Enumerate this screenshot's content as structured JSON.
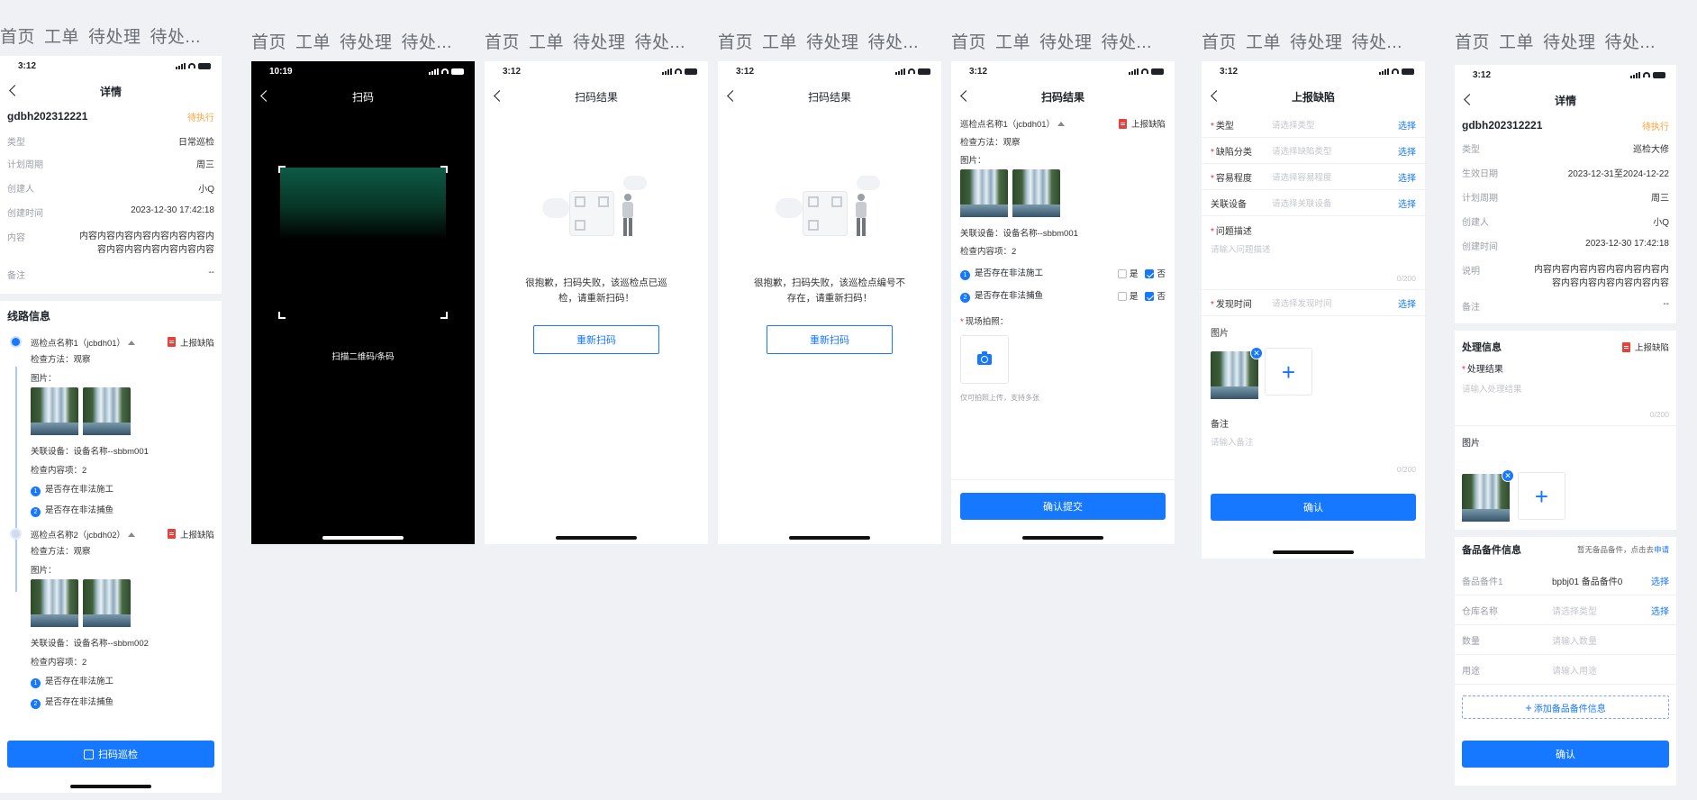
{
  "board_tabs": [
    "首页",
    "工单",
    "待处理",
    "待处..."
  ],
  "colors": {
    "primary": "#1677ff",
    "warning": "#f7a33b",
    "danger": "#e7413c"
  },
  "status_time": {
    "default": "3:12",
    "scan": "10:19"
  },
  "screen1": {
    "title": "详情",
    "code": "gdbh202312221",
    "status": "待执行",
    "fields": [
      {
        "k": "类型",
        "v": "日常巡检"
      },
      {
        "k": "计划周期",
        "v": "周三"
      },
      {
        "k": "创建人",
        "v": "小Q"
      },
      {
        "k": "创建时间",
        "v": "2023-12-30 17:42:18"
      },
      {
        "k": "内容",
        "v": "内容内容内容内容内容内容内容内容内容内容内容内容内容内容"
      },
      {
        "k": "备注",
        "v": "--"
      }
    ],
    "route_title": "线路信息",
    "report_label": "上报缺陷",
    "points": [
      {
        "name": "巡检点名称1（jcbdh01）",
        "method": "检查方法：观察",
        "pics": "图片：",
        "device": "关联设备：设备名称--sbbm001",
        "count": "检查内容项：2",
        "items": [
          "是否存在非法施工",
          "是否存在非法捕鱼"
        ]
      },
      {
        "name": "巡检点名称2（jcbdh02）",
        "method": "检查方法：观察",
        "pics": "图片：",
        "device": "关联设备：设备名称--sbbm002",
        "count": "检查内容项：2",
        "items": [
          "是否存在非法施工",
          "是否存在非法捕鱼"
        ]
      }
    ],
    "num_labels": [
      "1",
      "2"
    ],
    "button": "扫码巡检"
  },
  "screen2": {
    "title": "扫码",
    "tip": "扫描二维码/条码"
  },
  "screen3": {
    "title": "扫码结果",
    "message": "很抱歉，扫码失败，该巡检点已巡检，请重新扫码！",
    "button": "重新扫码"
  },
  "screen4": {
    "title": "扫码结果",
    "message": "很抱歉，扫码失败，该巡检点编号不存在，请重新扫码！",
    "button": "重新扫码"
  },
  "screen5": {
    "title": "扫码结果",
    "point": "巡检点名称1（jcbdh01）",
    "report_label": "上报缺陷",
    "method": "检查方法：观察",
    "pics": "图片：",
    "device": "关联设备：设备名称--sbbm001",
    "count": "检查内容项：2",
    "items": [
      "是否存在非法施工",
      "是否存在非法捕鱼"
    ],
    "num_labels": [
      "1",
      "2"
    ],
    "yes": "是",
    "no": "否",
    "photo_label": "现场拍照：",
    "photo_hint": "仅可拍照上传，支持多张",
    "button": "确认提交"
  },
  "screen6": {
    "title": "上报缺陷",
    "fields": [
      {
        "label": "类型",
        "ph": "请选择类型",
        "action": "选择",
        "req": true
      },
      {
        "label": "缺陷分类",
        "ph": "请选择缺陷类型",
        "action": "选择",
        "req": true
      },
      {
        "label": "容易程度",
        "ph": "请选择容易程度",
        "action": "选择",
        "req": true
      },
      {
        "label": "关联设备",
        "ph": "请选择关联设备",
        "action": "选择",
        "req": false
      }
    ],
    "desc_label": "问题描述",
    "desc_ph": "请输入问题描述",
    "counter": "0/200",
    "found_label": "发现时间",
    "found_ph": "请选择发现时间",
    "found_action": "选择",
    "pic_label": "图片",
    "remark_label": "备注",
    "remark_ph": "请输入备注",
    "remark_counter": "0/200",
    "button": "确认"
  },
  "screen7": {
    "title": "详情",
    "code": "gdbh202312221",
    "status": "待执行",
    "fields": [
      {
        "k": "类型",
        "v": "巡检大修"
      },
      {
        "k": "生效日期",
        "v": "2023-12-31至2024-12-22"
      },
      {
        "k": "计划周期",
        "v": "周三"
      },
      {
        "k": "创建人",
        "v": "小Q"
      },
      {
        "k": "创建时间",
        "v": "2023-12-30 17:42:18"
      },
      {
        "k": "说明",
        "v": "内容内容内容内容内容内容内容内容内容内容内容内容内容内容"
      },
      {
        "k": "备注",
        "v": "--"
      }
    ],
    "process_title": "处理信息",
    "report_label": "上报缺陷",
    "result_label": "处理结果",
    "result_ph": "请输入处理结果",
    "counter": "0/200",
    "pic_label": "图片",
    "spare_title": "备品备件信息",
    "spare_hint": "暂无备品备件，点击去",
    "spare_link": "申请",
    "spare_rows": [
      {
        "lab": "备品备件1",
        "val": "bpbj01 备品备件0",
        "action": "选择"
      },
      {
        "lab": "仓库名称",
        "val": "请选择类型",
        "action": "选择"
      },
      {
        "lab": "数量",
        "val": "请输入数量",
        "action": ""
      },
      {
        "lab": "用途",
        "val": "请输入用途",
        "action": ""
      }
    ],
    "add_spare": "添加备品备件信息",
    "button": "确认"
  }
}
